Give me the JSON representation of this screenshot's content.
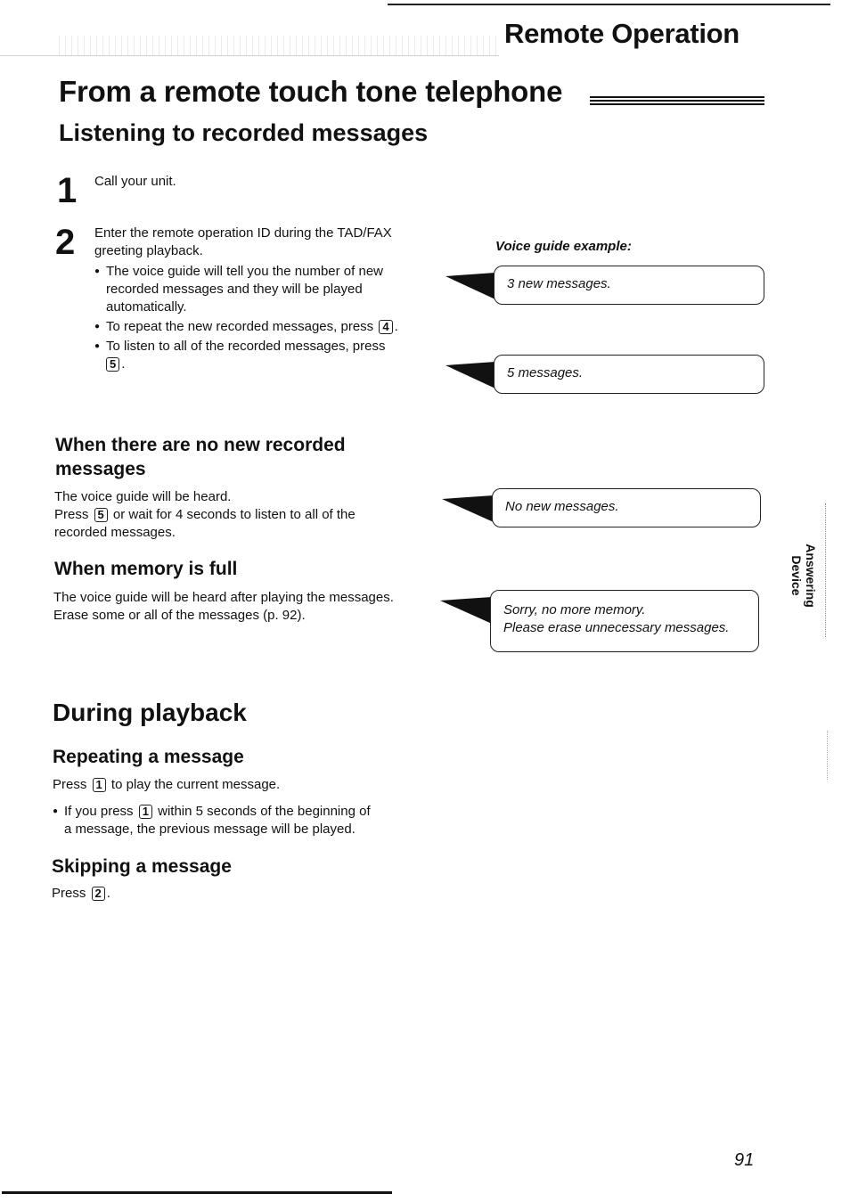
{
  "header": {
    "section": "Remote Operation"
  },
  "page_title": "From a remote touch tone telephone",
  "listening": {
    "title": "Listening to recorded messages",
    "steps": [
      {
        "number": "1",
        "text": "Call your unit."
      },
      {
        "number": "2",
        "text_line1": "Enter the remote operation ID during the TAD/FAX",
        "text_line2": "greeting playback.",
        "bullets": {
          "b1_line1": "The voice guide will tell you the number of new",
          "b1_line2": "recorded messages and they will be played",
          "b1_line3": "automatically.",
          "b2_text": "To repeat the new recorded messages, press",
          "b2_key": "4",
          "b2_end": ".",
          "b3_text": "To listen to all of the recorded messages, press",
          "b3_key": "5",
          "b3_end": "."
        }
      }
    ]
  },
  "voice_guide": {
    "label": "Voice guide example:",
    "bubbles": [
      {
        "line1": "3 new messages."
      },
      {
        "line1": "5 messages."
      },
      {
        "line1": "No new messages."
      },
      {
        "line1": "Sorry, no more memory.",
        "line2": "Please erase unnecessary messages."
      }
    ]
  },
  "no_new": {
    "title_line1": "When there are no new recorded",
    "title_line2": "messages",
    "line1": "The voice guide will be heard.",
    "line2_pre": "Press",
    "line2_key": "5",
    "line2_post": "or wait for 4 seconds to listen to all of the",
    "line3": "recorded messages."
  },
  "memory_full": {
    "title": "When memory is full",
    "line1": "The voice guide will be heard after playing the messages.",
    "line2": "Erase some or all of the messages (p. 92)."
  },
  "during_playback": {
    "title": "During playback",
    "repeating": {
      "title": "Repeating a message",
      "line_pre": "Press",
      "line_key": "1",
      "line_post": "to play the current message.",
      "bullet_pre": "If you press",
      "bullet_key": "1",
      "bullet_post": "within 5 seconds of the beginning of",
      "bullet_line2": "a message, the previous message will be played."
    },
    "skipping": {
      "title": "Skipping a message",
      "line_pre": "Press",
      "line_key": "2",
      "line_post": "."
    }
  },
  "side_tab": {
    "line1": "Answering",
    "line2": "Device"
  },
  "page_number": "91"
}
